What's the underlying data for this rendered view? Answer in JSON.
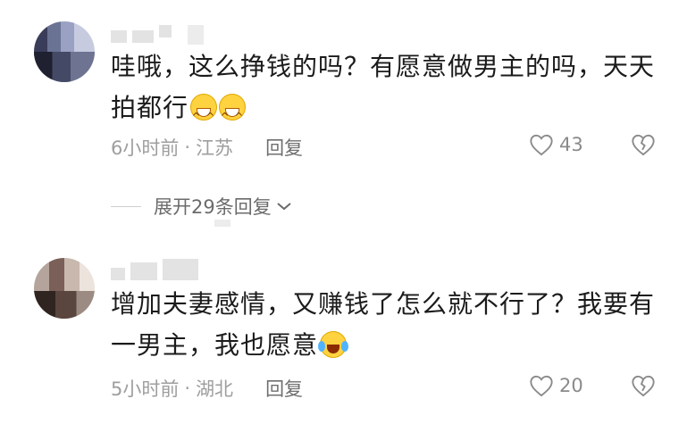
{
  "comments": [
    {
      "text": "哇哦，这么挣钱的吗？有愿意做男主的吗，天天拍都行",
      "emojis": [
        "grinning-face-icon",
        "grinning-face-icon"
      ],
      "time": "6小时前",
      "separator": "·",
      "location": "江苏",
      "reply_label": "回复",
      "likes": "43"
    },
    {
      "text": "增加夫妻感情，又赚钱了怎么就不行了？我要有一男主，我也愿意",
      "emojis": [
        "rolling-laughing-face-icon"
      ],
      "time": "5小时前",
      "separator": "·",
      "location": "湖北",
      "reply_label": "回复",
      "likes": "20"
    }
  ],
  "expand_replies": {
    "label": "展开29条回复"
  },
  "colors": {
    "text": "#1b1b1b",
    "meta": "#9e9e9e",
    "reply": "#6f6f6f",
    "icon": "#8a8a8a"
  }
}
